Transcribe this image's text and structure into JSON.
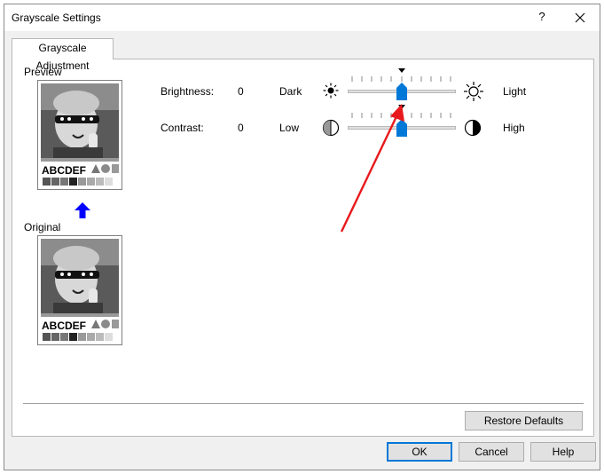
{
  "window": {
    "title": "Grayscale Settings",
    "help_glyph": "?"
  },
  "tabs": [
    {
      "label": "Grayscale Adjustment",
      "selected": true
    }
  ],
  "preview": {
    "label": "Preview",
    "caption": "ABCDEF"
  },
  "original": {
    "label": "Original",
    "caption": "ABCDEF"
  },
  "brightness": {
    "label": "Brightness:",
    "value": "0",
    "min_label": "Dark",
    "max_label": "Light",
    "level": 0.5
  },
  "contrast": {
    "label": "Contrast:",
    "value": "0",
    "min_label": "Low",
    "max_label": "High",
    "level": 0.5
  },
  "buttons": {
    "restore_defaults": "Restore Defaults",
    "ok": "OK",
    "cancel": "Cancel",
    "help": "Help"
  },
  "colors": {
    "accent": "#0078d7",
    "arrow_blue": "#0000ff",
    "annotation_red": "#e8191c"
  },
  "icons": [
    "close-icon",
    "sun-small-icon",
    "sun-large-icon",
    "half-circle-left-icon",
    "half-circle-right-icon",
    "up-arrow-icon"
  ]
}
